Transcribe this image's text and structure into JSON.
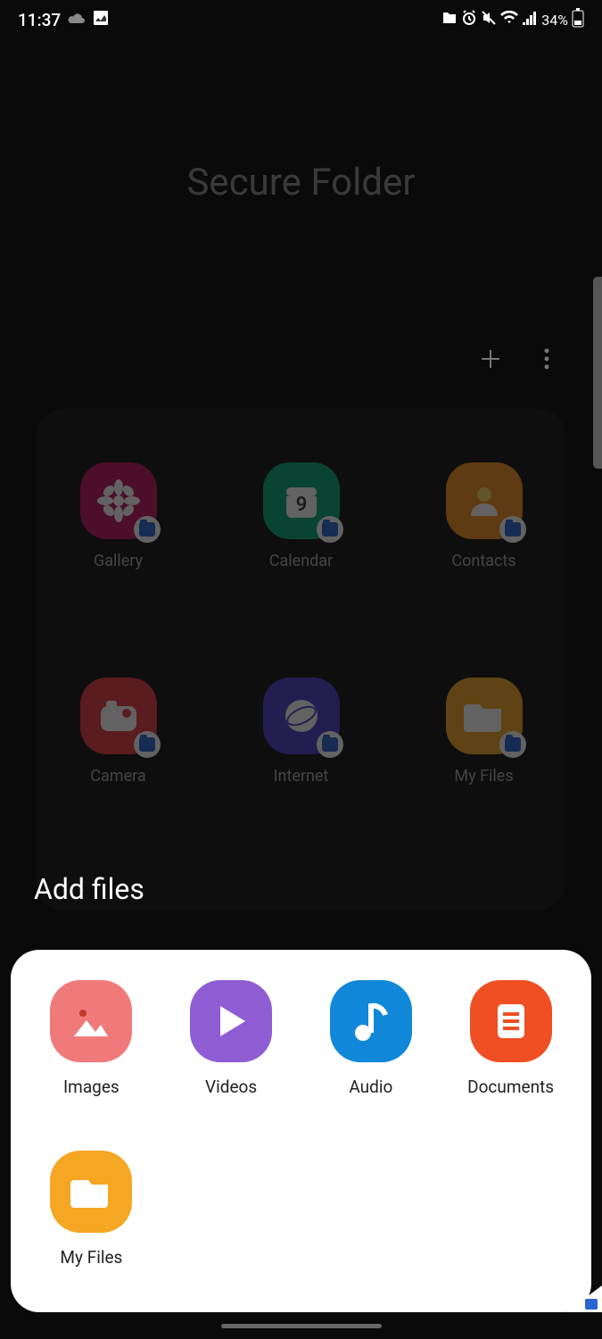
{
  "status": {
    "time": "11:37",
    "battery": "34%"
  },
  "page": {
    "title": "Secure Folder"
  },
  "apps": [
    {
      "label": "Gallery"
    },
    {
      "label": "Calendar"
    },
    {
      "label": "Contacts"
    },
    {
      "label": "Camera"
    },
    {
      "label": "Internet"
    },
    {
      "label": "My Files"
    }
  ],
  "sheet": {
    "title": "Add files",
    "items": [
      {
        "label": "Images"
      },
      {
        "label": "Videos"
      },
      {
        "label": "Audio"
      },
      {
        "label": "Documents"
      },
      {
        "label": "My Files"
      }
    ]
  },
  "calendar_date": "9"
}
